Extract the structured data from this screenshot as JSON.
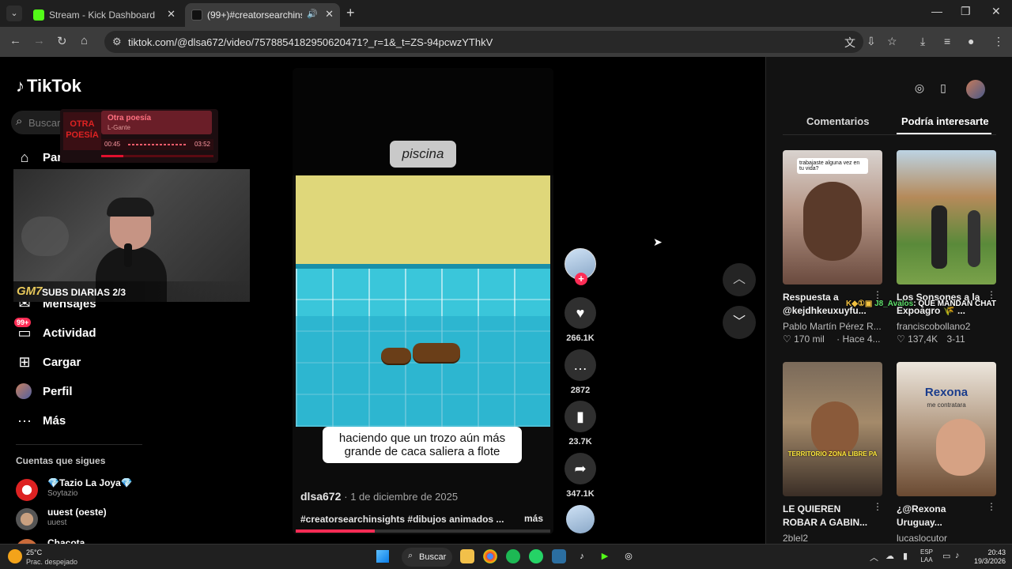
{
  "browser": {
    "tabs": [
      {
        "label": "Stream - Kick Dashboard",
        "favicon_color": "#53fc18"
      },
      {
        "label": "(99+)#creatorsearchinsights",
        "favicon_color": "#000000"
      }
    ],
    "url": "tiktok.com/@dlsa672/video/7578854182950620471?_r=1&_t=ZS-94pcwzYThkV",
    "new_tab_icon": "plus-icon",
    "window_controls": [
      "minimize-icon",
      "maximize-icon",
      "close-icon"
    ]
  },
  "tiktok": {
    "logo": "TikTok",
    "search_placeholder": "Buscar",
    "nav": [
      {
        "label": "Para ti",
        "icon": "home-icon"
      },
      {
        "label": "Mensajes",
        "icon": "message-icon"
      },
      {
        "label": "Actividad",
        "icon": "inbox-icon",
        "badge": "99+"
      },
      {
        "label": "Cargar",
        "icon": "upload-icon"
      },
      {
        "label": "Perfil",
        "icon": "profile-icon"
      },
      {
        "label": "Más",
        "icon": "more-icon"
      }
    ],
    "following_title": "Cuentas que sigues",
    "following": [
      {
        "name": "💎Tazio La Joya💎",
        "handle": "Soytazio"
      },
      {
        "name": "uuest (oeste)",
        "handle": "uuest"
      },
      {
        "name": "Chacota",
        "handle": ""
      }
    ]
  },
  "stream_overlay": {
    "music": {
      "title": "Otra poesía",
      "artist": "L-Gante",
      "art_text": "OTRA POESÍA",
      "elapsed": "00:45",
      "duration": "03:52",
      "progress": 0.2
    },
    "subs_label": "SUBS DIARIAS 2/3",
    "subs_logo": "GM7"
  },
  "video": {
    "top_caption": "piscina",
    "bottom_caption": "haciendo que un trozo aún más grande de caca saliera a flote",
    "author": "dlsa672",
    "date": "1 de diciembre de 2025",
    "hashtags": "#creatorsearchinsights #dibujos animados ...",
    "more": "más",
    "progress": 0.31,
    "likes": "266.1K",
    "comments": "2872",
    "saves": "23.7K",
    "shares": "347.1K"
  },
  "panel": {
    "tabs": [
      "Comentarios",
      "Podría interesarte"
    ],
    "active_tab": 1,
    "cards": [
      {
        "title": "Respuesta a @kejdhkeuxuyfu...",
        "author": "Pablo Martín Pérez R...",
        "likes": "170 mil",
        "age": "Hace 4...",
        "overlay": "trabajaste alguna vez en tu vida?"
      },
      {
        "title": "Los Sonsones a la Expoagro 🌾 ...",
        "author": "franciscobollano2",
        "likes": "137,4K",
        "age": "3-11"
      },
      {
        "title": "LE QUIEREN ROBAR A GABIN...",
        "author": "2blel2",
        "overlay": "TERRITORIO ZONA LIBRE PA"
      },
      {
        "title": "¿@Rexona Uruguay...",
        "author": "lucaslocutor",
        "overlay": "Rexona",
        "overlay_sub": "me contratara"
      }
    ]
  },
  "chat_overlay": {
    "user": "J8_Avalos",
    "message": "QUE MANDAN CHAT"
  },
  "taskbar": {
    "weather_temp": "25°C",
    "weather_desc": "Prac. despejado",
    "search_label": "Buscar",
    "lang_1": "ESP",
    "lang_2": "LAA",
    "time": "20:43",
    "date": "19/3/2026"
  }
}
